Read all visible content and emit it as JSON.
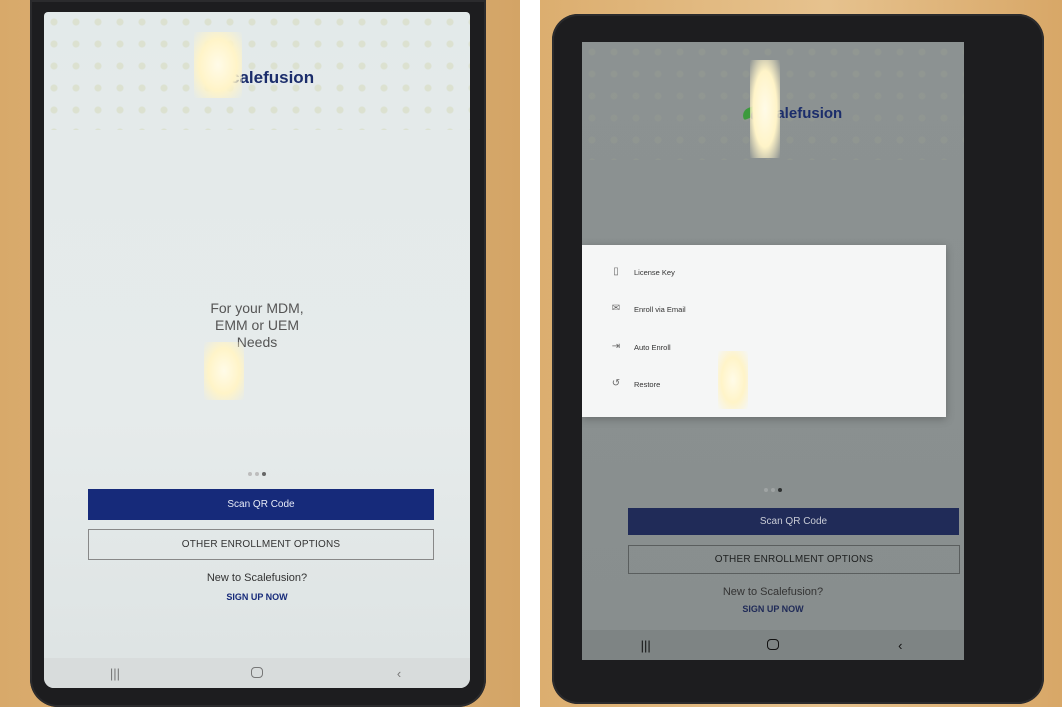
{
  "app": {
    "name": "Scalefusion",
    "logo_text": "calefusion"
  },
  "welcome": {
    "tagline": [
      "For your MDM,",
      "EMM or UEM",
      "Needs"
    ],
    "carousel": {
      "pages": 3,
      "active_index": 2
    }
  },
  "actions": {
    "scan_qr": "Scan QR Code",
    "other_options": "OTHER ENROLLMENT OPTIONS",
    "new_to": "New to Scalefusion?",
    "sign_up": "SIGN UP NOW"
  },
  "enrollment_menu": {
    "items": [
      {
        "label": "License Key",
        "icon": "license-key-icon"
      },
      {
        "label": "Enroll via Email",
        "icon": "email-icon"
      },
      {
        "label": "Auto Enroll",
        "icon": "auto-enroll-icon"
      },
      {
        "label": "Restore",
        "icon": "restore-icon"
      }
    ]
  },
  "navigation_bar": {
    "recents": "|||",
    "home": "home-icon",
    "back": "‹"
  },
  "colors": {
    "primary": "#162a7a",
    "logo_green": "#3c9a3c"
  }
}
